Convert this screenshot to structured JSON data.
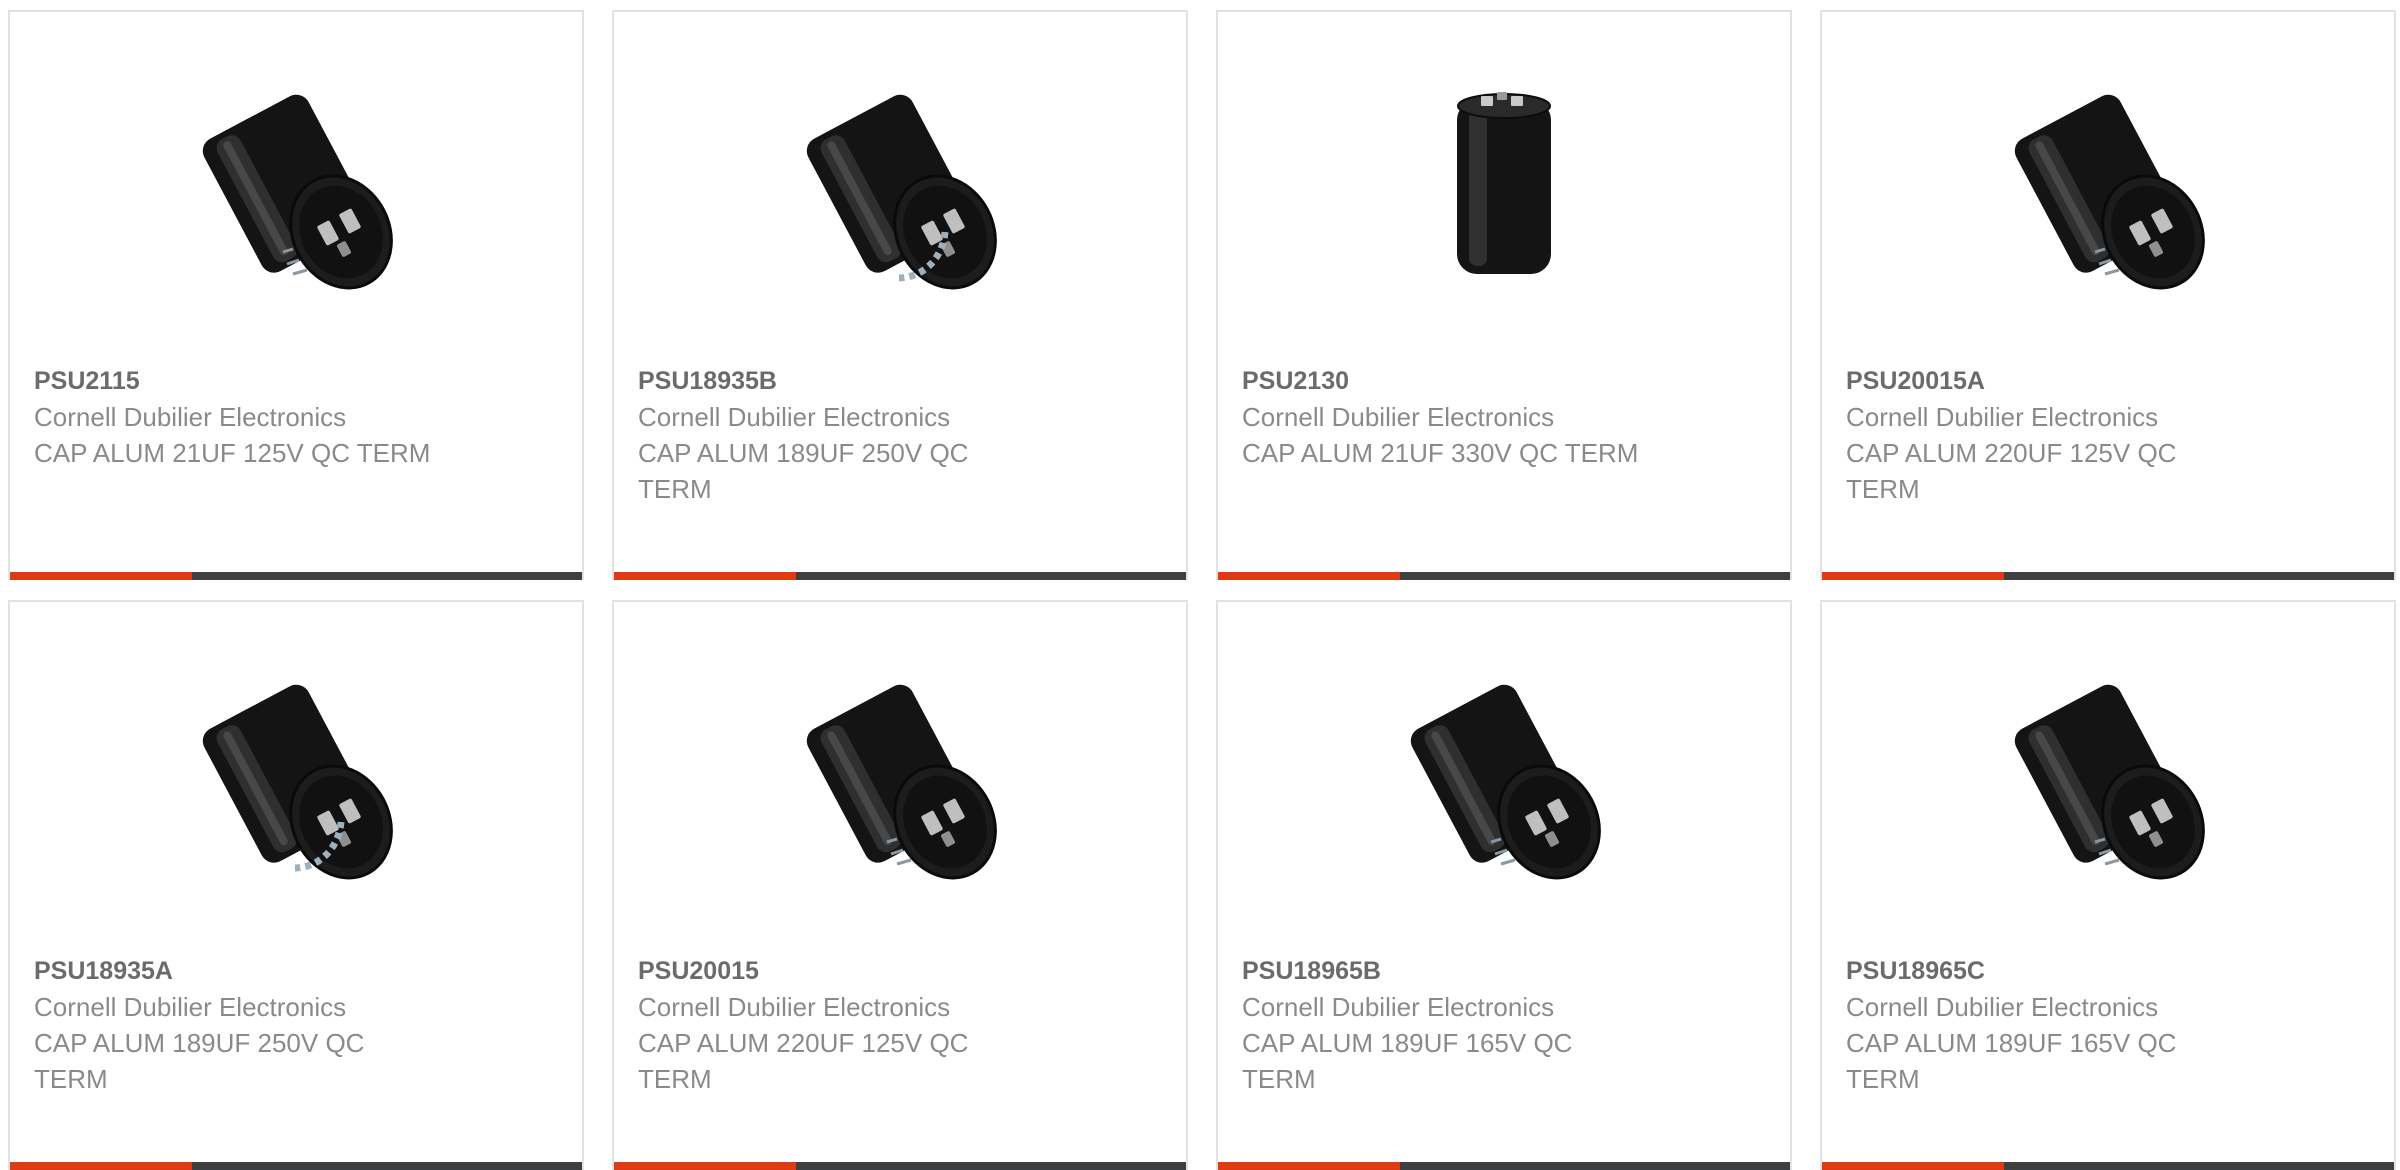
{
  "colors": {
    "accent": "#e03a12",
    "bar_dark": "#3d3f40",
    "capacitor_body": "#151515",
    "border": "#e2e2e2"
  },
  "products": [
    {
      "part_number": "PSU2115",
      "manufacturer": "Cornell Dubilier Electronics",
      "description": "CAP ALUM 21UF 125V QC TERM",
      "image": "capacitor-tilted-icon"
    },
    {
      "part_number": "PSU18935B",
      "manufacturer": "Cornell Dubilier Electronics",
      "description": "CAP ALUM 189UF 250V QC TERM",
      "image": "capacitor-tilted-ring-icon"
    },
    {
      "part_number": "PSU2130",
      "manufacturer": "Cornell Dubilier Electronics",
      "description": "CAP ALUM 21UF 330V QC TERM",
      "image": "capacitor-upright-icon"
    },
    {
      "part_number": "PSU20015A",
      "manufacturer": "Cornell Dubilier Electronics",
      "description": "CAP ALUM 220UF 125V QC TERM",
      "image": "capacitor-tilted-icon"
    },
    {
      "part_number": "PSU18935A",
      "manufacturer": "Cornell Dubilier Electronics",
      "description": "CAP ALUM 189UF 250V QC TERM",
      "image": "capacitor-tilted-ring-icon"
    },
    {
      "part_number": "PSU20015",
      "manufacturer": "Cornell Dubilier Electronics",
      "description": "CAP ALUM 220UF 125V QC TERM",
      "image": "capacitor-tilted-icon"
    },
    {
      "part_number": "PSU18965B",
      "manufacturer": "Cornell Dubilier Electronics",
      "description": "CAP ALUM 189UF 165V QC TERM",
      "image": "capacitor-tilted-icon"
    },
    {
      "part_number": "PSU18965C",
      "manufacturer": "Cornell Dubilier Electronics",
      "description": "CAP ALUM 189UF 165V QC TERM",
      "image": "capacitor-tilted-icon"
    }
  ]
}
